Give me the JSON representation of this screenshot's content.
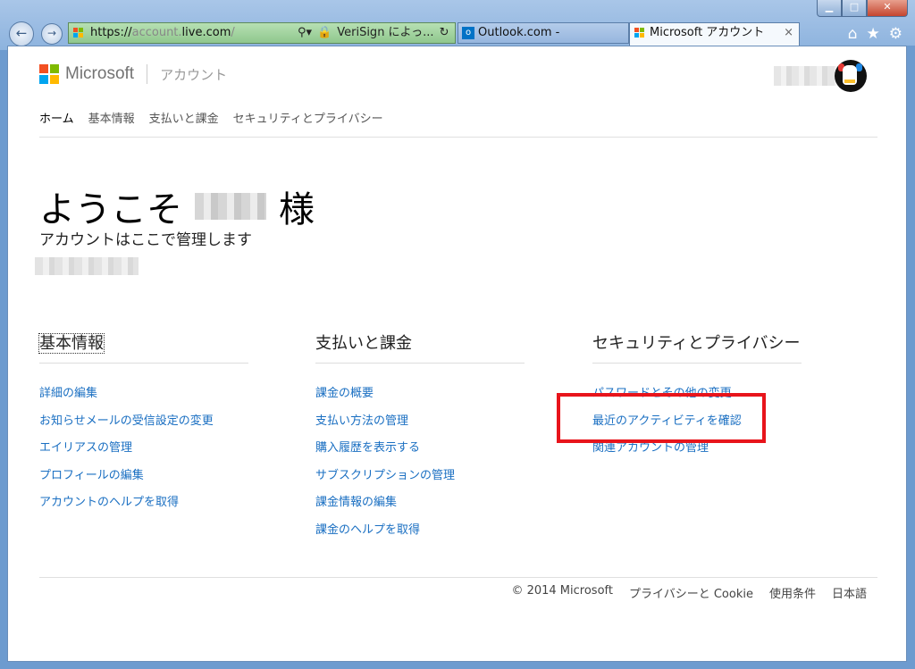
{
  "browser": {
    "url_prefix": "https://",
    "url_host_dim": "account.",
    "url_host": "live.com",
    "url_path": "/",
    "cert_label": "VeriSign によっ...",
    "tabs": [
      {
        "label": "Outlook.com - ",
        "active": false
      },
      {
        "label": "Microsoft アカウント",
        "active": true
      }
    ],
    "tab_close": "×",
    "window_controls": [
      "minimize",
      "maximize",
      "close"
    ]
  },
  "header": {
    "brand": "Microsoft",
    "section": "アカウント",
    "nav": [
      "ホーム",
      "基本情報",
      "支払いと課金",
      "セキュリティとプライバシー"
    ]
  },
  "welcome": {
    "greeting": "ようこそ",
    "suffix": "様",
    "subtitle": "アカウントはここで管理します"
  },
  "columns": [
    {
      "title": "基本情報",
      "links": [
        "詳細の編集",
        "お知らせメールの受信設定の変更",
        "エイリアスの管理",
        "プロフィールの編集",
        "アカウントのヘルプを取得"
      ]
    },
    {
      "title": "支払いと課金",
      "links": [
        "課金の概要",
        "支払い方法の管理",
        "購入履歴を表示する",
        "サブスクリプションの管理",
        "課金情報の編集",
        "課金のヘルプを取得"
      ]
    },
    {
      "title": "セキュリティとプライバシー",
      "links": [
        "パスワードとその他の変更",
        "最近のアクティビティを確認",
        "関連アカウントの管理"
      ]
    }
  ],
  "footer": {
    "copyright": "© 2014 Microsoft",
    "privacy": "プライバシーと Cookie",
    "terms": "使用条件",
    "language": "日本語"
  },
  "colors": {
    "link": "#1a6fc2",
    "highlight_box": "#e8141b",
    "ms_red": "#f25022",
    "ms_green": "#7fba00",
    "ms_blue": "#00a4ef",
    "ms_yellow": "#ffb900"
  }
}
